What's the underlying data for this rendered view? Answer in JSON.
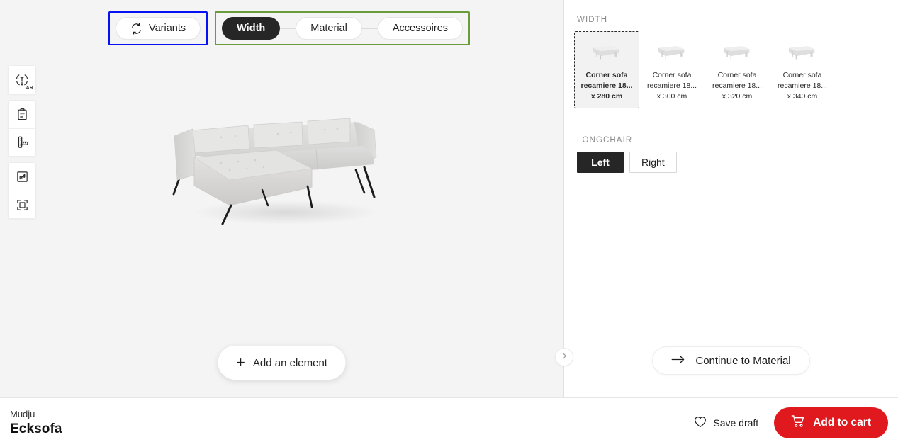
{
  "canvas": {
    "steps": {
      "variants_group": {
        "highlight_color": "#0511f2",
        "items": [
          {
            "label": "Variants",
            "icon": "variants-refresh-icon",
            "active": false
          }
        ]
      },
      "config_group": {
        "highlight_color": "#6b9c3b",
        "items": [
          {
            "label": "Width",
            "active": true
          },
          {
            "label": "Material",
            "active": false
          },
          {
            "label": "Accessoires",
            "active": false
          }
        ]
      }
    },
    "toolbar": [
      {
        "icon": "ar-view-icon",
        "badge": "AR"
      },
      {
        "icon": "clipboard-icon",
        "badge": ""
      },
      {
        "icon": "ruler-measure-icon",
        "badge": ""
      },
      {
        "icon": "expand-fullscreen-icon",
        "badge": ""
      },
      {
        "icon": "focus-frame-icon",
        "badge": ""
      }
    ],
    "add_element": {
      "label": "Add an element",
      "icon": "plus-icon"
    },
    "collapse_handle": {
      "icon": "chevron-right-icon"
    },
    "product_preview_alt": "Corner sofa recamiere light grey"
  },
  "panel": {
    "width_section": {
      "label": "WIDTH",
      "options": [
        {
          "line1": "Corner sofa",
          "line2": "recamiere 18...",
          "line3": "x 280 cm",
          "selected": true
        },
        {
          "line1": "Corner sofa",
          "line2": "recamiere 18...",
          "line3": "x 300 cm",
          "selected": false
        },
        {
          "line1": "Corner sofa",
          "line2": "recamiere 18...",
          "line3": "x 320 cm",
          "selected": false
        },
        {
          "line1": "Corner sofa",
          "line2": "recamiere 18...",
          "line3": "x 340 cm",
          "selected": false
        }
      ]
    },
    "longchair_section": {
      "label": "LONGCHAIR",
      "options": [
        {
          "label": "Left",
          "selected": true
        },
        {
          "label": "Right",
          "selected": false
        }
      ]
    },
    "continue_button": {
      "label": "Continue to Material",
      "icon": "arrow-right-icon"
    }
  },
  "bottombar": {
    "brand": "Mudju",
    "product": "Ecksofa",
    "save_draft": {
      "label": "Save draft",
      "icon": "heart-icon"
    },
    "add_to_cart": {
      "label": "Add to cart",
      "icon": "cart-icon",
      "color": "#e0191e"
    }
  }
}
